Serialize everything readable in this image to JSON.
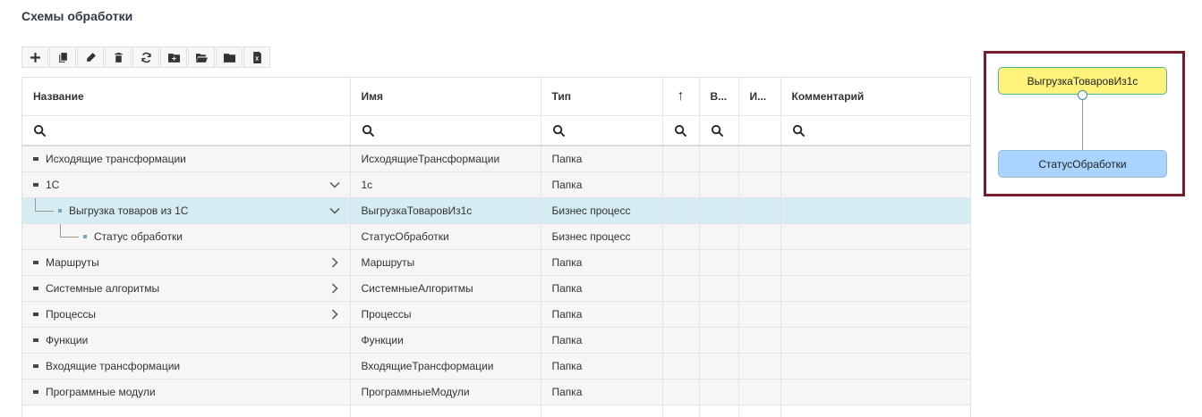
{
  "page": {
    "title": "Схемы обработки"
  },
  "toolbar": {
    "buttons": [
      {
        "icon": "plus-icon"
      },
      {
        "icon": "copy-icon"
      },
      {
        "icon": "edit-icon"
      },
      {
        "icon": "trash-icon"
      },
      {
        "icon": "refresh-icon"
      },
      {
        "icon": "folder-add-icon"
      },
      {
        "icon": "folder-open-icon"
      },
      {
        "icon": "folder-icon"
      },
      {
        "icon": "excel-icon"
      }
    ]
  },
  "table": {
    "columns": {
      "name": "Название",
      "id": "Имя",
      "type": "Тип",
      "sort": "↑",
      "v": "В...",
      "i": "И...",
      "comment": "Комментарий"
    },
    "rows": [
      {
        "name": "Исходящие трансформации",
        "id": "ИсходящиеТрансформации",
        "type": "Папка"
      },
      {
        "name": "1С",
        "id": "1с",
        "type": "Папка"
      },
      {
        "name": "Выгрузка товаров из 1С",
        "id": "ВыгрузкаТоваровИз1с",
        "type": "Бизнес процесс"
      },
      {
        "name": "Статус обработки",
        "id": "СтатусОбработки",
        "type": "Бизнес процесс"
      },
      {
        "name": "Маршруты",
        "id": "Маршруты",
        "type": "Папка"
      },
      {
        "name": "Системные алгоритмы",
        "id": "СистемныеАлгоритмы",
        "type": "Папка"
      },
      {
        "name": "Процессы",
        "id": "Процессы",
        "type": "Папка"
      },
      {
        "name": "Функции",
        "id": "Функции",
        "type": "Папка"
      },
      {
        "name": "Входящие трансформации",
        "id": "ВходящиеТрансформации",
        "type": "Папка"
      },
      {
        "name": "Программные модули",
        "id": "ПрограммныеМодули",
        "type": "Папка"
      }
    ]
  },
  "diagram": {
    "top_node": "ВыгрузкаТоваровИз1с",
    "bottom_node": "СтатусОбработки"
  },
  "colors": {
    "selected_row": "#d4ecf2",
    "node_top": "#fff27a",
    "node_bottom": "#a8d4ff",
    "diagram_border": "#7a1a2a"
  }
}
